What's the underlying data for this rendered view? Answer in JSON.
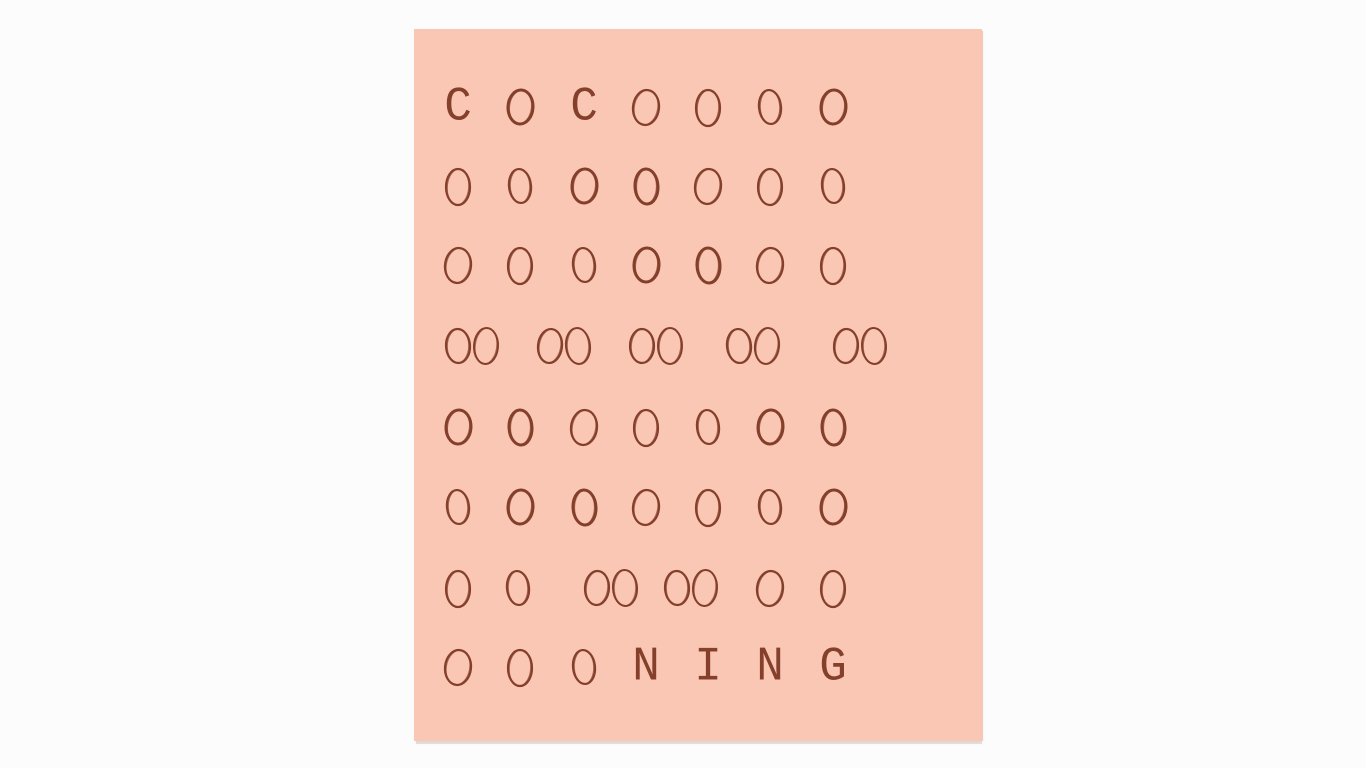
{
  "scene": {
    "wall_color": "#fcfcfc",
    "canvas_color": "#fbc7b5",
    "ink_color": "#7a3520"
  },
  "artwork": {
    "rows": [
      [
        "C",
        "O",
        "C",
        "O",
        "O",
        "O",
        "O"
      ],
      [
        "O",
        "O",
        "O",
        "O",
        "O",
        "O",
        "O"
      ],
      [
        "O",
        "O",
        "O",
        "O",
        "O",
        "O",
        "O"
      ],
      [
        "OO",
        "OO",
        "OO",
        "OO",
        "OO"
      ],
      [
        "O",
        "O",
        "O",
        "O",
        "O",
        "O",
        "O"
      ],
      [
        "O",
        "O",
        "O",
        "O",
        "O",
        "O",
        "O"
      ],
      [
        "O",
        "O",
        "OO",
        "OO",
        "O",
        "O"
      ],
      [
        "O",
        "O",
        "O",
        "N",
        "I",
        "N",
        "G"
      ]
    ]
  }
}
